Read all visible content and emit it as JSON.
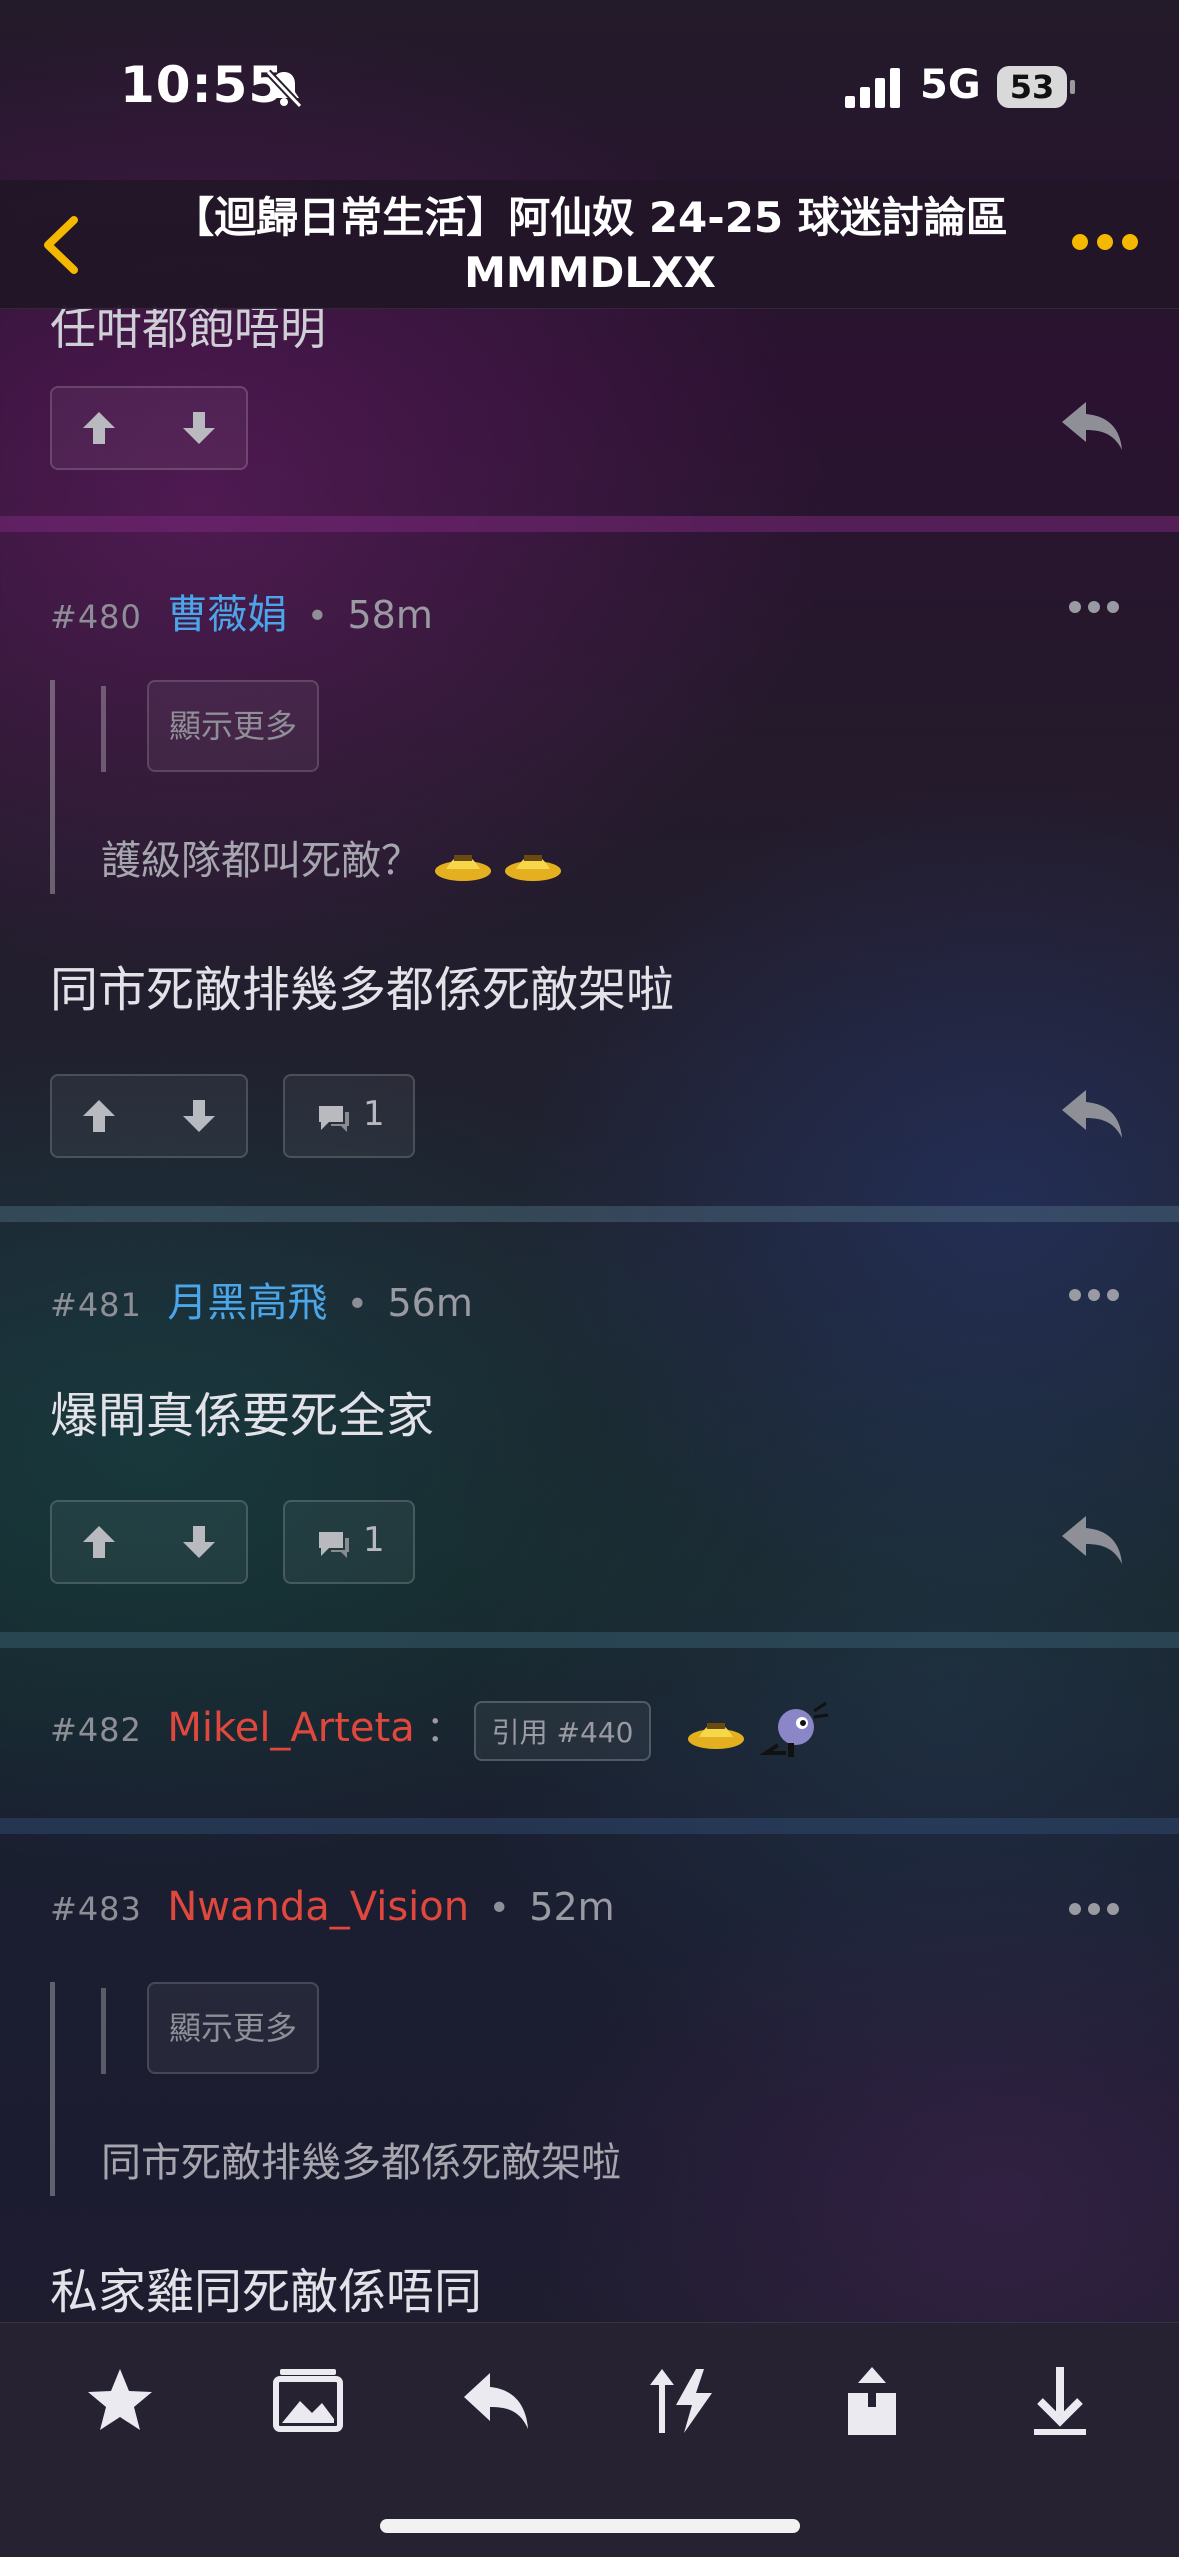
{
  "status": {
    "time": "10:55",
    "network": "5G",
    "battery": "53"
  },
  "nav": {
    "title": "【迴歸日常生活】阿仙奴 24-25 球迷討論區 MMMDLXX"
  },
  "peek_text": "任咁都飽唔明",
  "posts": [
    {
      "num": "#480",
      "user": "曹薇娟",
      "ago": "58m",
      "show_more": "顯示更多",
      "quote": "護級隊都叫死敵？",
      "body": "同市死敵排幾多都係死敵架啦",
      "comments": "1"
    },
    {
      "num": "#481",
      "user": "月黑高飛",
      "ago": "56m",
      "body": "爆閘真係要死全家",
      "comments": "1"
    },
    {
      "num": "#482",
      "user": "Mikel_Arteta",
      "colon": "：",
      "cite": "引用 #440"
    },
    {
      "num": "#483",
      "user": "Nwanda_Vision",
      "ago": "52m",
      "show_more": "顯示更多",
      "quote": "同市死敵排幾多都係死敵架啦",
      "body": "私家雞同死敵係唔同"
    }
  ],
  "separator": "•",
  "colors": {
    "accent": "#f5b800",
    "user_blue": "#4aa6e8",
    "user_red": "#e0473d"
  },
  "toolbar_icons": [
    "star-icon",
    "gallery-icon",
    "reply-icon",
    "sort-jump-icon",
    "share-icon",
    "download-icon"
  ]
}
